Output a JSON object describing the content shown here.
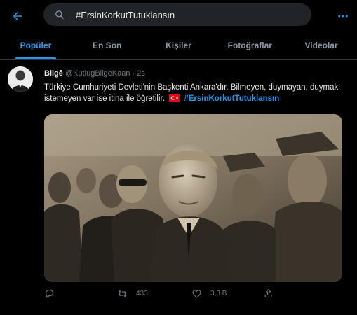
{
  "search": {
    "value": "#ErsinKorkutTutuklansın"
  },
  "tabs": [
    {
      "label": "Popüler",
      "active": true
    },
    {
      "label": "En Son"
    },
    {
      "label": "Kişiler"
    },
    {
      "label": "Fotoğraflar"
    },
    {
      "label": "Videolar"
    }
  ],
  "tweet": {
    "author_name": "Bilgê",
    "handle": "@KutlugBilgeKaan",
    "separator": "·",
    "time": "2s",
    "text": "Türkiye Cumhuriyeti Devleti'nin Başkenti Ankara'dır. Bilmeyen, duymayan, duymak istemeyen var ise itina ile öğretilir.",
    "flag_emoji": "turkey-flag",
    "hashtag": "#ErsinKorkutTutuklansın",
    "retweet_count": "433",
    "like_count": "3,3 B"
  },
  "colors": {
    "accent": "#1d9bf0",
    "background": "#000000",
    "muted": "#6e767d"
  },
  "icons": [
    "back-arrow-icon",
    "search-icon",
    "more-icon",
    "reply-icon",
    "retweet-icon",
    "like-icon",
    "share-icon"
  ]
}
